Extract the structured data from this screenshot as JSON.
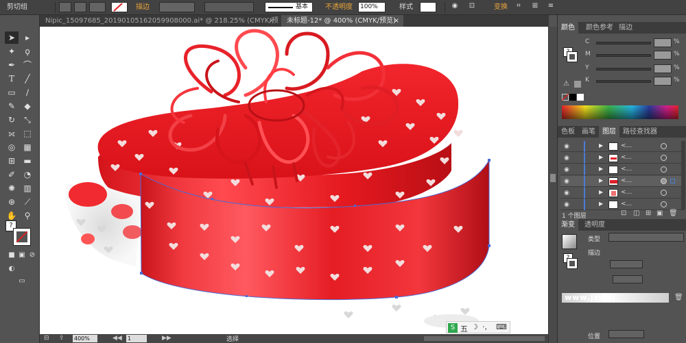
{
  "control_bar": {
    "group_label": "剪切组",
    "stroke_label": "描边",
    "stroke_style": "基本",
    "opacity_label": "不透明度",
    "opacity_value": "100%",
    "style_label": "样式",
    "transform_label": "变换"
  },
  "tabs": [
    {
      "label": "Nipic_15097685_20190105162059908000.ai* @ 218.25% (CMYK/预览)",
      "close": "×"
    },
    {
      "label": "未标题-12* @ 400% (CMYK/预览)",
      "close": "×"
    }
  ],
  "status_bar": {
    "zoom": "400%",
    "page": "1",
    "mode": "选择"
  },
  "color_panel": {
    "tabs": [
      "颜色",
      "颜色参考",
      "描边"
    ],
    "channels": [
      "C",
      "M",
      "Y",
      "K"
    ],
    "pct": "%"
  },
  "layers_panel": {
    "tabs": [
      "色板",
      "画笔",
      "图层",
      "路径查找器"
    ],
    "rows": [
      {
        "name": "<...",
        "eye": "◉"
      },
      {
        "name": "<...",
        "eye": "◉"
      },
      {
        "name": "<...",
        "eye": "◉"
      },
      {
        "name": "<...",
        "eye": "◉"
      },
      {
        "name": "<...",
        "eye": "◉"
      },
      {
        "name": "<...",
        "eye": "◉"
      }
    ],
    "footer": "1 个图层"
  },
  "gradient_panel": {
    "tabs": [
      "渐变",
      "透明度"
    ],
    "type_label": "类型",
    "stroke_label": "描边",
    "position_label": "位置"
  },
  "watermark": {
    "text": "www.jzwei",
    "ime_label": "五"
  },
  "icons": {
    "selection": "selection-arrow-icon",
    "direct": "direct-selection-icon",
    "eye": "eye-icon",
    "trash": "trash-icon"
  },
  "colors": {
    "accent_orange": "#e8a43a",
    "ribbon_red": "#e8222a",
    "panel_bg": "#535353"
  }
}
